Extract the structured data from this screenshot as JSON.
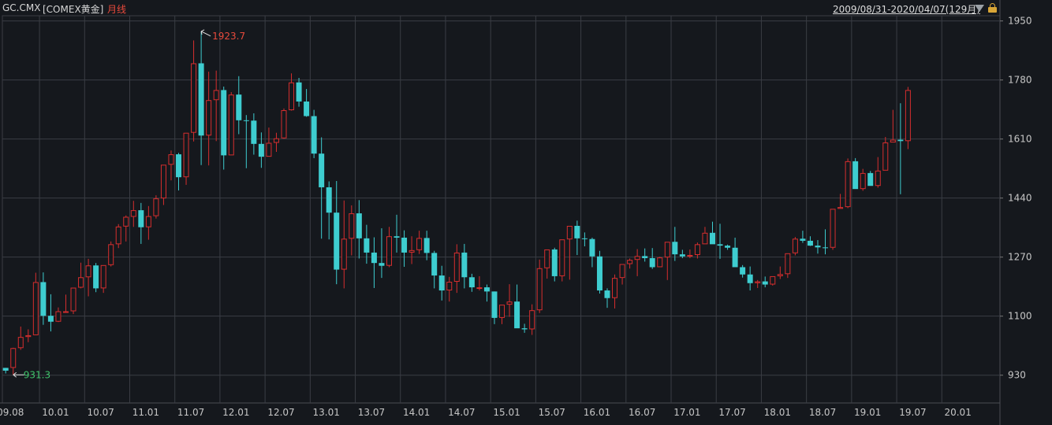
{
  "header": {
    "symbol": "GC.CMX",
    "exchange": "[COMEX黄金]",
    "period": "月线",
    "range": "2009/08/31-2020/04/07(129月)"
  },
  "colors": {
    "up": "#d62e2e",
    "down": "#3ecdd0",
    "grid": "#3a3d44",
    "background": "#15181d"
  },
  "chart_data": {
    "type": "candlestick",
    "ylim": [
      850,
      1965
    ],
    "y_ticks": [
      "1950",
      "1780",
      "1610",
      "1440",
      "1270",
      "1100",
      "930"
    ],
    "y_tick_values": [
      1950,
      1780,
      1610,
      1440,
      1270,
      1100,
      930
    ],
    "x_tick_labels": [
      "09.08",
      "10.01",
      "10.07",
      "11.01",
      "11.07",
      "12.01",
      "12.07",
      "13.01",
      "13.07",
      "14.01",
      "14.07",
      "15.01",
      "15.07",
      "16.01",
      "16.07",
      "17.01",
      "17.07",
      "18.01",
      "18.07",
      "19.01",
      "19.07",
      "20.01"
    ],
    "annotations": {
      "max_label": "1923.7",
      "min_label": "931.3"
    },
    "candles": [
      [
        951,
        951,
        935,
        943
      ],
      [
        951,
        1009,
        931,
        1008
      ],
      [
        1008,
        1070,
        1003,
        1040
      ],
      [
        1040,
        1062,
        1025,
        1045
      ],
      [
        1045,
        1225,
        1045,
        1198
      ],
      [
        1198,
        1226,
        1075,
        1101
      ],
      [
        1101,
        1163,
        1056,
        1084
      ],
      [
        1084,
        1125,
        1083,
        1114
      ],
      [
        1114,
        1162,
        1112,
        1114
      ],
      [
        1114,
        1180,
        1106,
        1182
      ],
      [
        1182,
        1254,
        1180,
        1212
      ],
      [
        1212,
        1265,
        1157,
        1246
      ],
      [
        1246,
        1253,
        1169,
        1180
      ],
      [
        1180,
        1210,
        1167,
        1247
      ],
      [
        1247,
        1315,
        1243,
        1307
      ],
      [
        1307,
        1365,
        1296,
        1358
      ],
      [
        1358,
        1390,
        1315,
        1386
      ],
      [
        1386,
        1432,
        1357,
        1405
      ],
      [
        1405,
        1426,
        1308,
        1356
      ],
      [
        1356,
        1417,
        1320,
        1388
      ],
      [
        1388,
        1448,
        1381,
        1439
      ],
      [
        1439,
        1488,
        1420,
        1536
      ],
      [
        1536,
        1577,
        1491,
        1566
      ],
      [
        1566,
        1570,
        1462,
        1500
      ],
      [
        1500,
        1542,
        1478,
        1628
      ],
      [
        1628,
        1894,
        1603,
        1828
      ],
      [
        1828,
        1920,
        1535,
        1620
      ],
      [
        1620,
        1804,
        1534,
        1722
      ],
      [
        1722,
        1807,
        1604,
        1751
      ],
      [
        1751,
        1761,
        1522,
        1563
      ],
      [
        1563,
        1745,
        1592,
        1738
      ],
      [
        1738,
        1791,
        1624,
        1664
      ],
      [
        1664,
        1679,
        1526,
        1663
      ],
      [
        1663,
        1684,
        1565,
        1596
      ],
      [
        1596,
        1629,
        1527,
        1559
      ],
      [
        1559,
        1643,
        1561,
        1599
      ],
      [
        1599,
        1628,
        1573,
        1612
      ],
      [
        1612,
        1698,
        1611,
        1693
      ],
      [
        1693,
        1799,
        1692,
        1773
      ],
      [
        1773,
        1786,
        1703,
        1718
      ],
      [
        1718,
        1754,
        1674,
        1676
      ],
      [
        1676,
        1694,
        1555,
        1568
      ],
      [
        1568,
        1615,
        1323,
        1471
      ],
      [
        1471,
        1488,
        1321,
        1398
      ],
      [
        1398,
        1489,
        1192,
        1234
      ],
      [
        1234,
        1433,
        1180,
        1323
      ],
      [
        1323,
        1419,
        1275,
        1396
      ],
      [
        1396,
        1434,
        1266,
        1324
      ],
      [
        1324,
        1363,
        1251,
        1283
      ],
      [
        1283,
        1327,
        1181,
        1253
      ],
      [
        1253,
        1353,
        1210,
        1245
      ],
      [
        1245,
        1357,
        1241,
        1330
      ],
      [
        1330,
        1392,
        1283,
        1326
      ],
      [
        1326,
        1347,
        1242,
        1283
      ],
      [
        1283,
        1330,
        1250,
        1290
      ],
      [
        1290,
        1346,
        1279,
        1325
      ],
      [
        1325,
        1346,
        1261,
        1282
      ],
      [
        1282,
        1288,
        1180,
        1217
      ],
      [
        1217,
        1245,
        1145,
        1174
      ],
      [
        1174,
        1213,
        1142,
        1199
      ],
      [
        1199,
        1307,
        1167,
        1283
      ],
      [
        1283,
        1308,
        1180,
        1212
      ],
      [
        1212,
        1222,
        1170,
        1183
      ],
      [
        1183,
        1215,
        1174,
        1183
      ],
      [
        1183,
        1191,
        1142,
        1171
      ],
      [
        1171,
        1171,
        1077,
        1095
      ],
      [
        1095,
        1123,
        1077,
        1133
      ],
      [
        1133,
        1192,
        1098,
        1142
      ],
      [
        1142,
        1191,
        1072,
        1065
      ],
      [
        1065,
        1078,
        1052,
        1062
      ],
      [
        1062,
        1134,
        1046,
        1117
      ],
      [
        1117,
        1263,
        1109,
        1238
      ],
      [
        1238,
        1284,
        1208,
        1292
      ],
      [
        1292,
        1297,
        1200,
        1215
      ],
      [
        1215,
        1274,
        1200,
        1321
      ],
      [
        1321,
        1340,
        1205,
        1360
      ],
      [
        1360,
        1375,
        1276,
        1324
      ],
      [
        1324,
        1341,
        1301,
        1322
      ],
      [
        1322,
        1326,
        1241,
        1272
      ],
      [
        1272,
        1288,
        1165,
        1174
      ],
      [
        1174,
        1180,
        1124,
        1152
      ],
      [
        1152,
        1220,
        1122,
        1210
      ],
      [
        1210,
        1250,
        1191,
        1250
      ],
      [
        1250,
        1266,
        1237,
        1262
      ],
      [
        1262,
        1293,
        1215,
        1273
      ],
      [
        1273,
        1295,
        1257,
        1267
      ],
      [
        1267,
        1296,
        1236,
        1241
      ],
      [
        1241,
        1271,
        1246,
        1269
      ],
      [
        1269,
        1306,
        1204,
        1314
      ],
      [
        1314,
        1357,
        1259,
        1278
      ],
      [
        1278,
        1291,
        1267,
        1272
      ],
      [
        1272,
        1292,
        1267,
        1276
      ],
      [
        1276,
        1312,
        1266,
        1307
      ],
      [
        1307,
        1357,
        1310,
        1340
      ],
      [
        1340,
        1372,
        1333,
        1307
      ],
      [
        1307,
        1366,
        1265,
        1303
      ],
      [
        1303,
        1306,
        1291,
        1297
      ],
      [
        1297,
        1326,
        1281,
        1241
      ],
      [
        1241,
        1247,
        1211,
        1220
      ],
      [
        1220,
        1243,
        1174,
        1195
      ],
      [
        1195,
        1204,
        1181,
        1200
      ],
      [
        1200,
        1214,
        1183,
        1191
      ],
      [
        1191,
        1212,
        1188,
        1215
      ],
      [
        1215,
        1243,
        1207,
        1221
      ],
      [
        1221,
        1266,
        1210,
        1281
      ],
      [
        1281,
        1328,
        1275,
        1323
      ],
      [
        1323,
        1346,
        1311,
        1317
      ],
      [
        1317,
        1330,
        1302,
        1303
      ],
      [
        1303,
        1319,
        1280,
        1298
      ],
      [
        1298,
        1350,
        1278,
        1297
      ],
      [
        1297,
        1347,
        1291,
        1409
      ],
      [
        1409,
        1452,
        1411,
        1414
      ],
      [
        1414,
        1554,
        1411,
        1546
      ],
      [
        1546,
        1555,
        1484,
        1466
      ],
      [
        1466,
        1524,
        1461,
        1512
      ],
      [
        1512,
        1518,
        1481,
        1475
      ],
      [
        1475,
        1558,
        1470,
        1519
      ],
      [
        1519,
        1616,
        1520,
        1600
      ],
      [
        1600,
        1694,
        1605,
        1608
      ],
      [
        1608,
        1713,
        1451,
        1604
      ],
      [
        1604,
        1760,
        1581,
        1751
      ]
    ]
  }
}
